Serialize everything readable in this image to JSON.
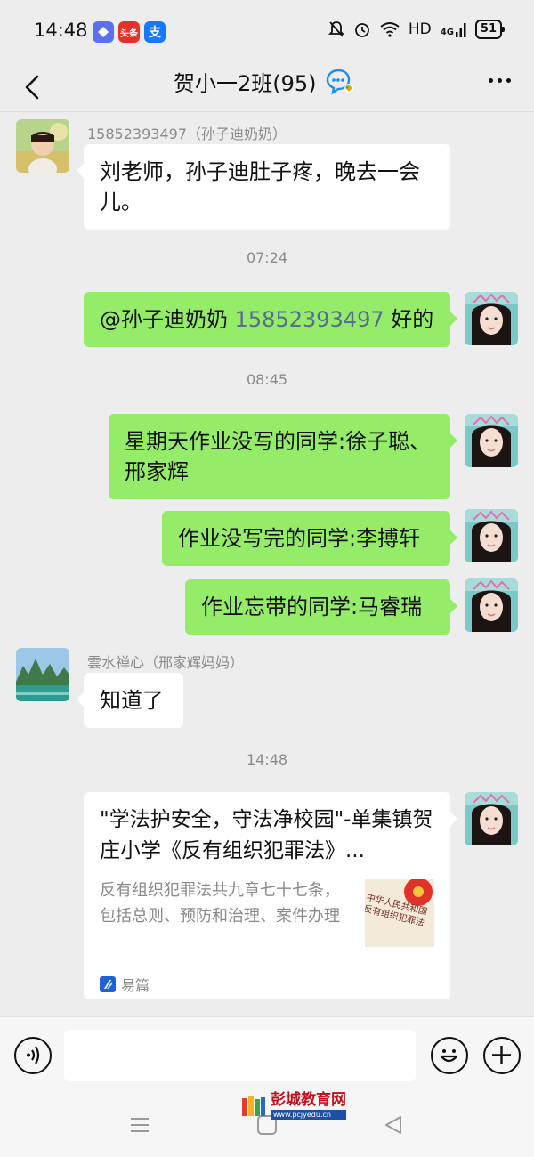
{
  "status_bar": {
    "time": "14:48",
    "app_icons": [
      "meituan-app-icon",
      "toutiao-app-icon",
      "alipay-app-icon"
    ],
    "toutiao_label": "头条",
    "alipay_label": "支",
    "network": "HD",
    "signal": "4G",
    "battery": "51"
  },
  "header": {
    "title": "贺小一2班(95)"
  },
  "messages": [
    {
      "sender": "15852393497（孙子迪奶奶）",
      "text": "刘老师，孙子迪肚子疼，晚去一会儿。"
    },
    {
      "timestamp": "07:24",
      "mention": "@孙子迪奶奶",
      "mention_number": "15852393497",
      "text": "好的"
    },
    {
      "timestamp": "08:45",
      "text": "星期天作业没写的同学:徐子聪、邢家辉"
    },
    {
      "text": "作业没写完的同学:李搏轩"
    },
    {
      "text": "作业忘带的同学:马睿瑞"
    },
    {
      "sender": "雲水禅心（邢家辉妈妈）",
      "text": "知道了"
    },
    {
      "timestamp": "14:48"
    }
  ],
  "card": {
    "title": "\"学法护安全，守法净校园\"-单集镇贺庄小学《反有组织犯罪法》...",
    "description": "反有组织犯罪法共九章七十七条，包括总则、预防和治理、案件办理",
    "thumb_text": "中华人民共和国反有组织犯罪法",
    "source": "易篇"
  },
  "input_bar": {
    "placeholder": ""
  },
  "watermark": {
    "name": "彭城教育网",
    "url": "www.pcjyedu.cn"
  }
}
